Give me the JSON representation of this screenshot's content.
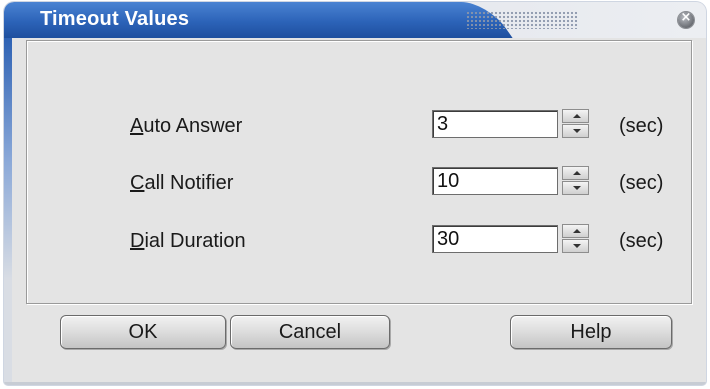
{
  "dialog": {
    "title": "Timeout Values"
  },
  "fields": [
    {
      "label_access": "A",
      "label_rest": "uto Answer",
      "value": "3",
      "unit": "(sec)"
    },
    {
      "label_access": "C",
      "label_rest": "all Notifier",
      "value": "10",
      "unit": "(sec)"
    },
    {
      "label_access": "D",
      "label_rest": "ial Duration",
      "value": "30",
      "unit": "(sec)"
    }
  ],
  "buttons": {
    "ok": "OK",
    "cancel": "Cancel",
    "help": "Help"
  },
  "colors": {
    "title_bar": "#2c63b8",
    "dialog_bg": "#e4e4e4"
  },
  "icons": {
    "close": "close-icon",
    "spin_up": "chevron-up-icon",
    "spin_down": "chevron-down-icon",
    "grip": "drag-grip-icon"
  }
}
